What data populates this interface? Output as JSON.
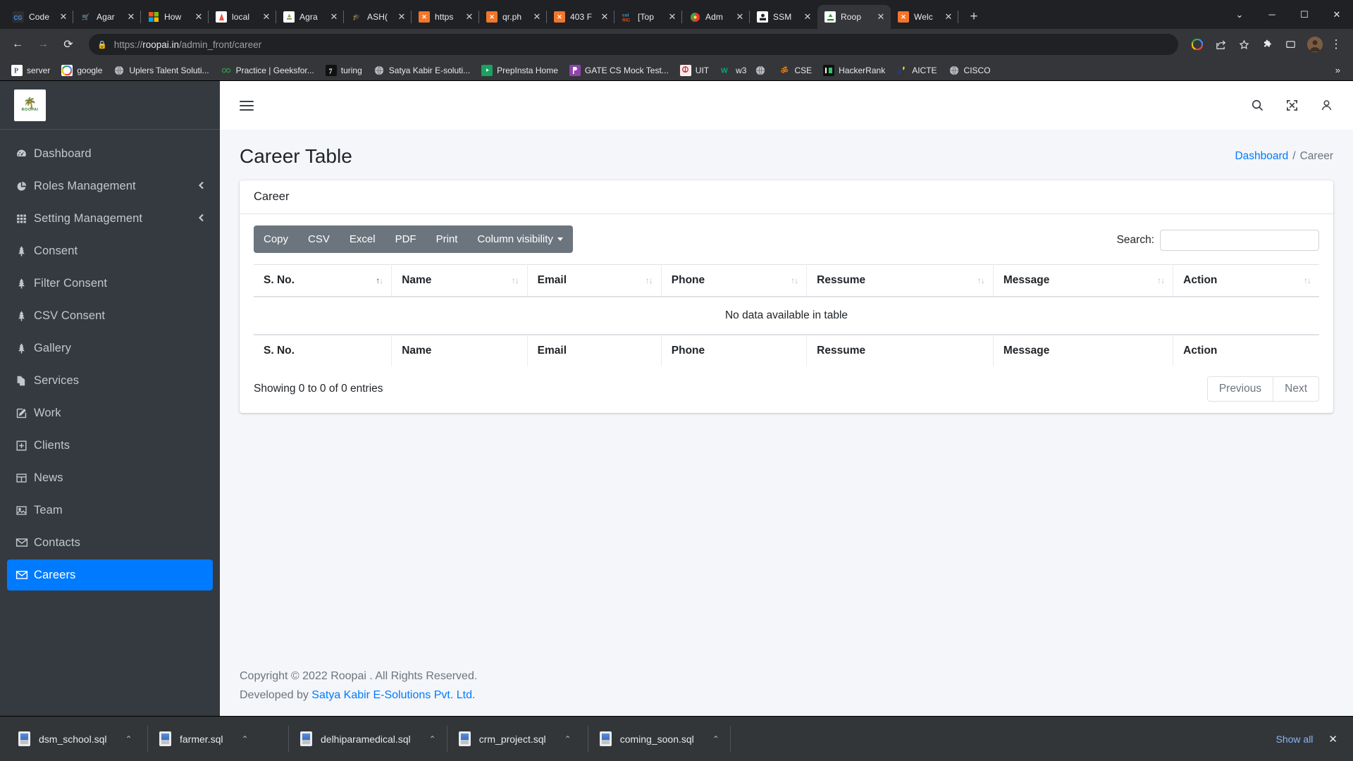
{
  "browser": {
    "tabs": [
      {
        "title": "Code",
        "icon_name": "codegrepper-icon",
        "fav_text": "CG",
        "fav_bg": "#2b2f33",
        "fav_fg": "#4a90d9",
        "active": false
      },
      {
        "title": "Agar",
        "icon_name": "cart-icon",
        "fav_text": "🛒",
        "fav_bg": "transparent",
        "fav_fg": "#9aa0a6",
        "active": false
      },
      {
        "title": "How",
        "icon_name": "microsoft-icon",
        "fav_text": "",
        "fav_bg": "transparent",
        "fav_fg": "#fff",
        "active": false
      },
      {
        "title": "local",
        "icon_name": "laravel-icon",
        "fav_text": "",
        "fav_bg": "#ffffff",
        "fav_fg": "#f05340",
        "active": false
      },
      {
        "title": "Agra",
        "icon_name": "agra-site-icon",
        "fav_text": "",
        "fav_bg": "#ffffff",
        "fav_fg": "#8a6d3b",
        "active": false
      },
      {
        "title": "ASH(",
        "icon_name": "graduation-cap-icon",
        "fav_text": "🎓",
        "fav_bg": "transparent",
        "fav_fg": "#cfd3d6",
        "active": false
      },
      {
        "title": "https",
        "icon_name": "xampp-icon",
        "fav_text": "✕",
        "fav_bg": "#f4752a",
        "fav_fg": "#ffffff",
        "active": false
      },
      {
        "title": "qr.ph",
        "icon_name": "xampp-icon",
        "fav_text": "✕",
        "fav_bg": "#f4752a",
        "fav_fg": "#ffffff",
        "active": false
      },
      {
        "title": "403 F",
        "icon_name": "xampp-icon",
        "fav_text": "✕",
        "fav_bg": "#f4752a",
        "fav_fg": "#ffffff",
        "active": false
      },
      {
        "title": "[Top",
        "icon_name": "tutorialspoint-icon",
        "fav_text": "",
        "fav_bg": "transparent",
        "fav_fg": "#e8491d",
        "active": false
      },
      {
        "title": "Adm",
        "icon_name": "swirl-icon",
        "fav_text": "",
        "fav_bg": "transparent",
        "fav_fg": "#e53935",
        "active": false
      },
      {
        "title": "SSM",
        "icon_name": "ssm-icon",
        "fav_text": "",
        "fav_bg": "#ffffff",
        "fav_fg": "#222222",
        "active": false
      },
      {
        "title": "Roop",
        "icon_name": "roopai-icon",
        "fav_text": "",
        "fav_bg": "#ffffff",
        "fav_fg": "#3c9a3c",
        "active": true
      },
      {
        "title": "Welc",
        "icon_name": "xampp-icon",
        "fav_text": "✕",
        "fav_bg": "#f4752a",
        "fav_fg": "#ffffff",
        "active": false
      }
    ],
    "new_tab_label": "+",
    "window_controls": {
      "minimize": "─",
      "maximize": "☐",
      "close": "✕",
      "dropdown": "⌄"
    },
    "nav": {
      "back": "←",
      "forward": "→",
      "reload": "⟳"
    },
    "omnibox": {
      "lock_icon": "🔒",
      "url_prefix": "https://",
      "url_host": "roopai.in",
      "url_path": "/admin_front/career"
    },
    "toolbar_icons": [
      {
        "name": "google-g-icon",
        "glyph": "G"
      },
      {
        "name": "share-icon",
        "glyph": "↱"
      },
      {
        "name": "bookmark-star-icon",
        "glyph": "☆"
      },
      {
        "name": "extensions-puzzle-icon",
        "glyph": "⛭"
      },
      {
        "name": "cast-icon",
        "glyph": "▭"
      },
      {
        "name": "profile-avatar",
        "glyph": ""
      },
      {
        "name": "chrome-menu-icon",
        "glyph": "⋮"
      }
    ],
    "bookmarks": [
      {
        "label": "server",
        "icon_name": "phpmyadmin-icon",
        "glyph": "P",
        "bg": "#ffffff",
        "fg": "#3b5b92"
      },
      {
        "label": "google",
        "icon_name": "google-icon",
        "glyph": "G",
        "bg": "#ffffff",
        "fg": "#4285f4"
      },
      {
        "label": "Uplers Talent Soluti...",
        "icon_name": "globe-icon",
        "glyph": "🌐",
        "bg": "transparent",
        "fg": "#9aa0a6"
      },
      {
        "label": "Practice | Geeksfor...",
        "icon_name": "geeksforgeeks-icon",
        "glyph": "∞",
        "bg": "transparent",
        "fg": "#2f8d46"
      },
      {
        "label": "turing",
        "icon_name": "turing-icon",
        "glyph": "7",
        "bg": "#111111",
        "fg": "#ffffff"
      },
      {
        "label": "Satya Kabir E-soluti...",
        "icon_name": "globe-icon",
        "glyph": "🌐",
        "bg": "transparent",
        "fg": "#9aa0a6"
      },
      {
        "label": "PrepInsta Home",
        "icon_name": "prepinsta-icon",
        "glyph": "▶",
        "bg": "#1aa260",
        "fg": "#ffffff"
      },
      {
        "label": "GATE CS Mock Test...",
        "icon_name": "gate-icon",
        "glyph": "β",
        "bg": "#8e44ad",
        "fg": "#ffffff"
      },
      {
        "label": "UIT",
        "icon_name": "uit-icon",
        "glyph": "❁",
        "bg": "#ffffff",
        "fg": "#c62828"
      },
      {
        "label": "w3",
        "icon_name": "w3schools-icon",
        "glyph": "W",
        "bg": "transparent",
        "fg": "#04aa6d"
      },
      {
        "label": "",
        "icon_name": "globe-icon",
        "glyph": "🌐",
        "bg": "transparent",
        "fg": "#9aa0a6"
      },
      {
        "label": "CSE",
        "icon_name": "cse-icon",
        "glyph": "ॐ",
        "bg": "transparent",
        "fg": "#f57c00"
      },
      {
        "label": "HackerRank",
        "icon_name": "hackerrank-icon",
        "glyph": "H",
        "bg": "#111111",
        "fg": "#2ec866"
      },
      {
        "label": "AICTE",
        "icon_name": "aicte-icon",
        "glyph": "A",
        "bg": "transparent",
        "fg": "#2b3a8f"
      },
      {
        "label": "CISCO",
        "icon_name": "globe-icon",
        "glyph": "🌐",
        "bg": "transparent",
        "fg": "#9aa0a6"
      }
    ],
    "bookmarks_overflow": "»"
  },
  "app": {
    "brand": {
      "tree_glyph": "🌴",
      "name": "ROOPAI"
    },
    "topbar": {
      "hamburger_name": "menu-toggle",
      "icons": [
        {
          "name": "search-icon",
          "glyph": "⌕"
        },
        {
          "name": "fullscreen-icon",
          "glyph": "⛶"
        },
        {
          "name": "user-icon",
          "glyph": "○"
        }
      ]
    },
    "sidebar": {
      "items": [
        {
          "label": "Dashboard",
          "icon": "dashboard-gauge-icon",
          "arrow": "",
          "active": false
        },
        {
          "label": "Roles Management",
          "icon": "pie-chart-icon",
          "arrow": "‹",
          "active": false
        },
        {
          "label": "Setting Management",
          "icon": "grid-icon",
          "arrow": "‹",
          "active": false
        },
        {
          "label": "Consent",
          "icon": "tree-icon",
          "arrow": "",
          "active": false
        },
        {
          "label": "Filter Consent",
          "icon": "tree-icon",
          "arrow": "",
          "active": false
        },
        {
          "label": "CSV Consent",
          "icon": "tree-icon",
          "arrow": "",
          "active": false
        },
        {
          "label": "Gallery",
          "icon": "tree-icon",
          "arrow": "",
          "active": false
        },
        {
          "label": "Services",
          "icon": "copy-pages-icon",
          "arrow": "",
          "active": false
        },
        {
          "label": "Work",
          "icon": "edit-pencil-icon",
          "arrow": "",
          "active": false
        },
        {
          "label": "Clients",
          "icon": "plus-box-icon",
          "arrow": "",
          "active": false
        },
        {
          "label": "News",
          "icon": "table-icon",
          "arrow": "",
          "active": false
        },
        {
          "label": "Team",
          "icon": "image-icon",
          "arrow": "",
          "active": false
        },
        {
          "label": "Contacts",
          "icon": "envelope-icon",
          "arrow": "",
          "active": false
        },
        {
          "label": "Careers",
          "icon": "envelope-icon",
          "arrow": "",
          "active": true
        }
      ],
      "active_color": "#007bff"
    },
    "page": {
      "title": "Career Table",
      "breadcrumb": {
        "home": "Dashboard",
        "separator": "/",
        "current": "Career"
      },
      "card_title": "Career"
    },
    "datatable": {
      "buttons": [
        {
          "label": "Copy",
          "name": "copy-button",
          "caret": false
        },
        {
          "label": "CSV",
          "name": "csv-button",
          "caret": false
        },
        {
          "label": "Excel",
          "name": "excel-button",
          "caret": false
        },
        {
          "label": "PDF",
          "name": "pdf-button",
          "caret": false
        },
        {
          "label": "Print",
          "name": "print-button",
          "caret": false
        },
        {
          "label": "Column visibility",
          "name": "column-visibility-button",
          "caret": true
        }
      ],
      "search_label": "Search:",
      "search_value": "",
      "search_placeholder": "",
      "columns": [
        "S. No.",
        "Name",
        "Email",
        "Phone",
        "Ressume",
        "Message",
        "Action"
      ],
      "sorted_column_index": 0,
      "empty_message": "No data available in table",
      "info": "Showing 0 to 0 of 0 entries",
      "pagination": {
        "previous": "Previous",
        "next": "Next"
      }
    },
    "footer": {
      "copyright": "Copyright © 2022 Roopai . All Rights Reserved.",
      "developed_prefix": "Developed by ",
      "developer": "Satya Kabir E-Solutions Pvt. Ltd."
    }
  },
  "downloads": {
    "items": [
      {
        "name": "dsm_school.sql",
        "caret": "⌃"
      },
      {
        "name": "farmer.sql",
        "caret": "⌃"
      },
      {
        "name": "delhiparamedical.sql",
        "caret": "⌃"
      },
      {
        "name": "crm_project.sql",
        "caret": "⌃"
      },
      {
        "name": "coming_soon.sql",
        "caret": "⌃"
      }
    ],
    "show_all": "Show all",
    "close": "✕"
  }
}
